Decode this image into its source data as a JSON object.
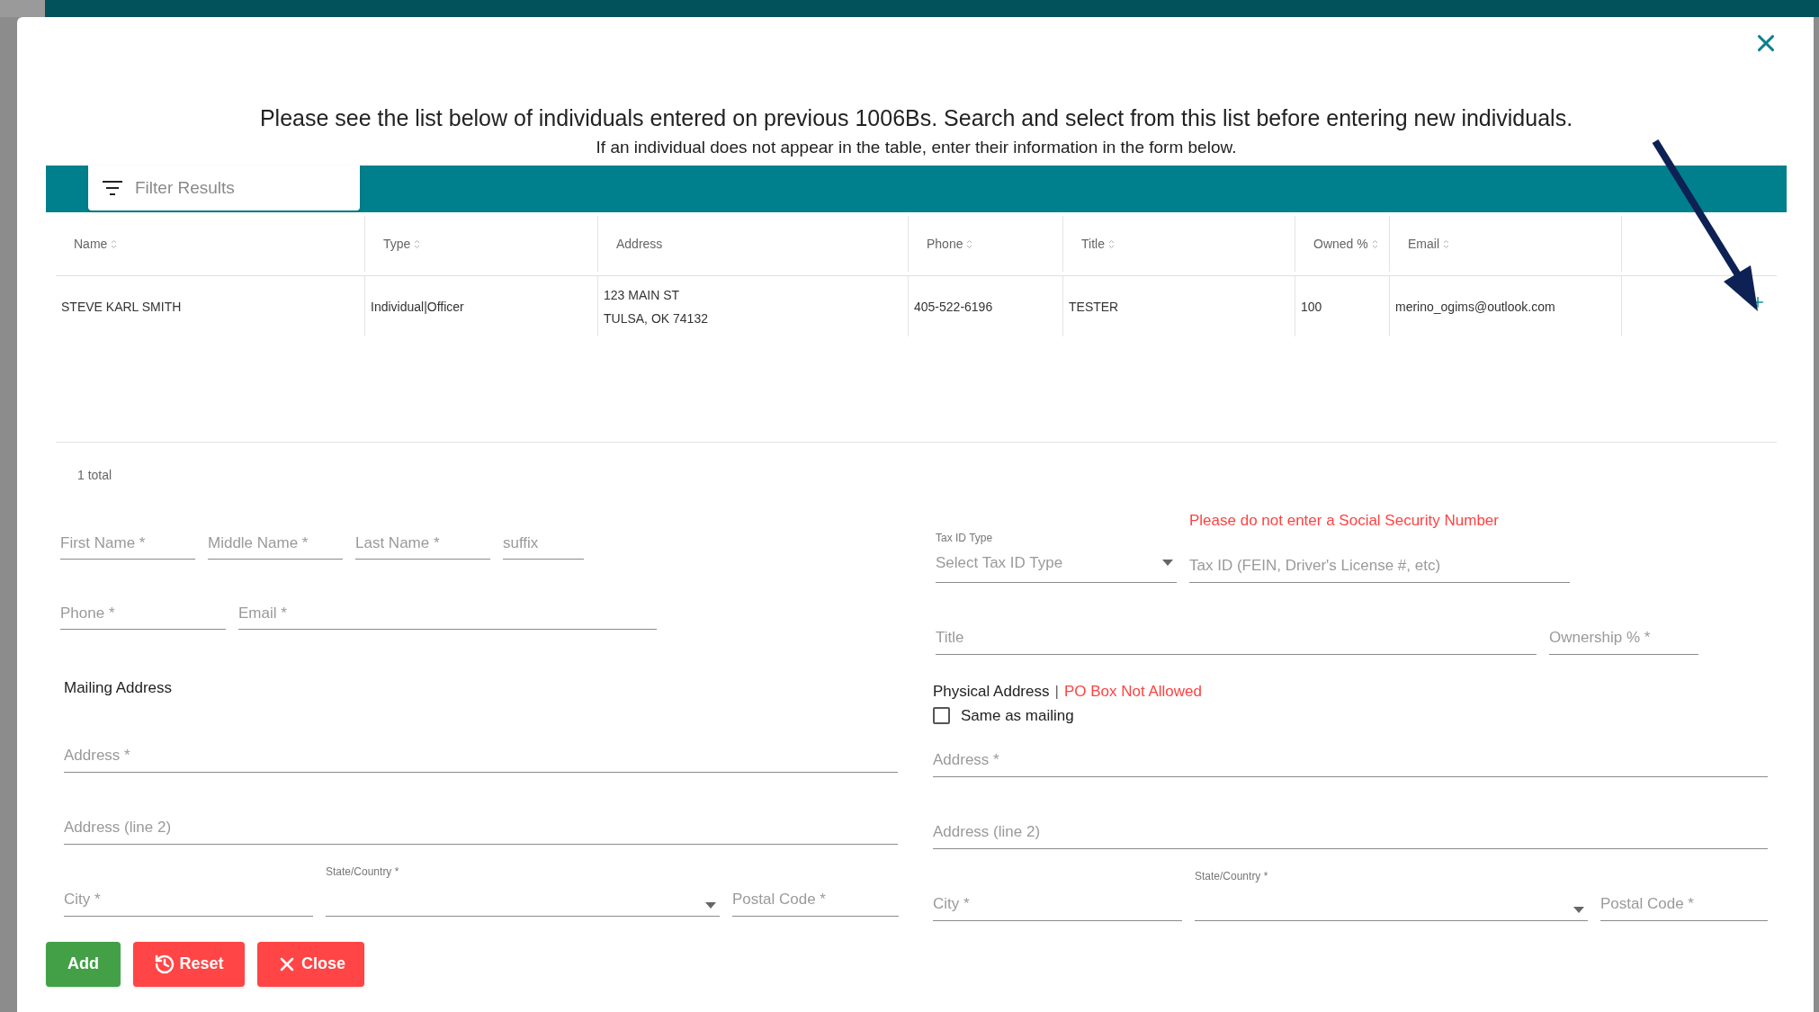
{
  "heading": "Please see the list below of individuals entered on previous 1006Bs. Search and select from this list before entering new individuals.",
  "subheading": "If an individual does not appear in the table, enter their information in the form below.",
  "table": {
    "filter": {
      "placeholder": "Filter Results"
    },
    "columns": [
      {
        "label": "Name",
        "sortable": true
      },
      {
        "label": "Type",
        "sortable": true
      },
      {
        "label": "Address",
        "sortable": false
      },
      {
        "label": "Phone",
        "sortable": true
      },
      {
        "label": "Title",
        "sortable": true
      },
      {
        "label": "Owned %",
        "sortable": true
      },
      {
        "label": "Email",
        "sortable": true
      }
    ],
    "rows": [
      {
        "cells": [
          [
            "STEVE KARL SMITH"
          ],
          [
            "Individual|Officer"
          ],
          [
            "123 MAIN ST",
            "TULSA, OK 74132"
          ],
          [
            "405-522-6196"
          ],
          [
            "TESTER"
          ],
          [
            "100"
          ],
          [
            "merino_ogims@outlook.com"
          ]
        ]
      }
    ],
    "total": "1 total"
  },
  "person_rows": [
    [
      {
        "kind": "text",
        "placeholder": "First Name *"
      },
      {
        "kind": "text",
        "placeholder": "Middle Name *"
      },
      {
        "kind": "text",
        "placeholder": "Last Name *"
      },
      {
        "kind": "text",
        "placeholder": "suffix"
      }
    ],
    [
      {
        "kind": "text",
        "placeholder": "Phone *"
      },
      {
        "kind": "text",
        "placeholder": "Email *"
      }
    ]
  ],
  "tax": {
    "warning": "Please do not enter a Social Security Number",
    "rows": [
      [
        {
          "kind": "select",
          "label": "Tax ID Type",
          "placeholder": "Select Tax ID Type"
        },
        {
          "kind": "text",
          "placeholder": "Tax ID (FEIN, Driver's License #, etc)"
        }
      ],
      [
        {
          "kind": "text",
          "placeholder": "Title"
        },
        {
          "kind": "text",
          "placeholder": "Ownership % *"
        }
      ]
    ]
  },
  "mailing_address": {
    "heading": "Mailing Address",
    "rows": [
      [
        {
          "kind": "text",
          "placeholder": "Address *"
        }
      ],
      [
        {
          "kind": "text",
          "placeholder": "Address (line 2)"
        }
      ],
      [
        {
          "kind": "text",
          "placeholder": "City *"
        },
        {
          "kind": "select",
          "label": "State/Country *"
        },
        {
          "kind": "text",
          "placeholder": "Postal Code *"
        }
      ]
    ]
  },
  "physical_address": {
    "heading": "Physical Address",
    "separator": "|",
    "note": "PO Box Not Allowed",
    "same_as_mailing": {
      "label": "Same as mailing",
      "checked": false
    },
    "rows": [
      [
        {
          "kind": "text",
          "placeholder": "Address *"
        }
      ],
      [
        {
          "kind": "text",
          "placeholder": "Address (line 2)"
        }
      ],
      [
        {
          "kind": "text",
          "placeholder": "City *"
        },
        {
          "kind": "select",
          "label": "State/Country *"
        },
        {
          "kind": "text",
          "placeholder": "Postal Code *"
        }
      ]
    ]
  },
  "buttons": [
    {
      "kind": "add",
      "label": "Add"
    },
    {
      "kind": "reset",
      "label": "Reset"
    },
    {
      "kind": "close",
      "label": "Close"
    }
  ]
}
